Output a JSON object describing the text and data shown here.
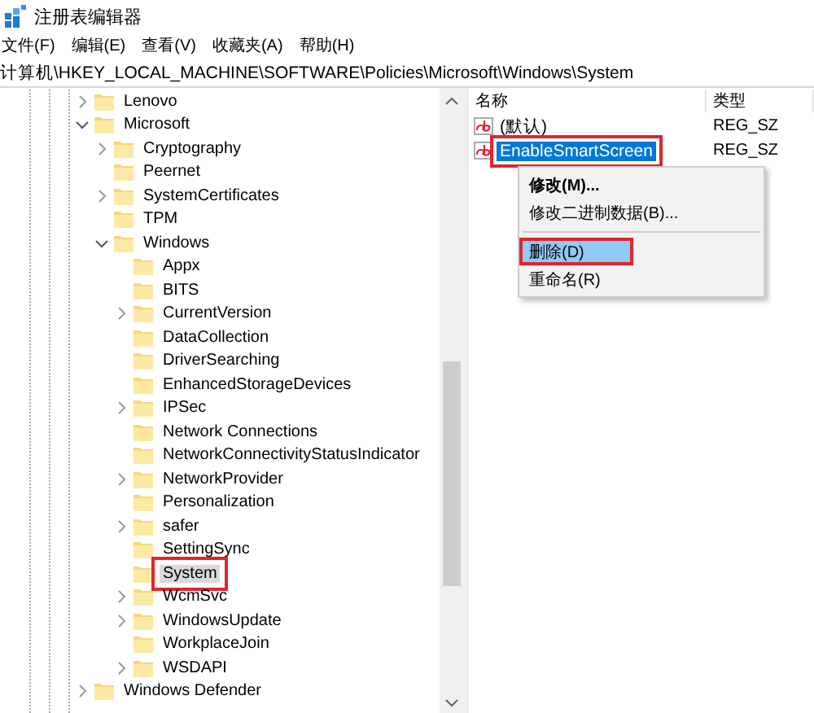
{
  "window": {
    "title": "注册表编辑器"
  },
  "menu": [
    "文件(F)",
    "编辑(E)",
    "查看(V)",
    "收藏夹(A)",
    "帮助(H)"
  ],
  "address": "计算机\\HKEY_LOCAL_MACHINE\\SOFTWARE\\Policies\\Microsoft\\Windows\\System",
  "tree": [
    {
      "label": "Lenovo",
      "kind": "node",
      "expanded": false,
      "selected": false
    },
    {
      "label": "Microsoft",
      "kind": "node",
      "expanded": true,
      "selected": false,
      "children": [
        {
          "label": "Cryptography",
          "kind": "node",
          "expanded": false,
          "selected": false
        },
        {
          "label": "Peernet",
          "kind": "leaf",
          "selected": false
        },
        {
          "label": "SystemCertificates",
          "kind": "node",
          "expanded": false,
          "selected": false
        },
        {
          "label": "TPM",
          "kind": "leaf",
          "selected": false
        },
        {
          "label": "Windows",
          "kind": "node",
          "expanded": true,
          "selected": false,
          "children": [
            {
              "label": "Appx",
              "kind": "leaf",
              "selected": false
            },
            {
              "label": "BITS",
              "kind": "leaf",
              "selected": false
            },
            {
              "label": "CurrentVersion",
              "kind": "node",
              "expanded": false,
              "selected": false
            },
            {
              "label": "DataCollection",
              "kind": "leaf",
              "selected": false
            },
            {
              "label": "DriverSearching",
              "kind": "leaf",
              "selected": false
            },
            {
              "label": "EnhancedStorageDevices",
              "kind": "leaf",
              "selected": false
            },
            {
              "label": "IPSec",
              "kind": "node",
              "expanded": false,
              "selected": false
            },
            {
              "label": "Network Connections",
              "kind": "leaf",
              "selected": false
            },
            {
              "label": "NetworkConnectivityStatusIndicator",
              "kind": "leaf",
              "selected": false
            },
            {
              "label": "NetworkProvider",
              "kind": "node",
              "expanded": false,
              "selected": false
            },
            {
              "label": "Personalization",
              "kind": "leaf",
              "selected": false
            },
            {
              "label": "safer",
              "kind": "node",
              "expanded": false,
              "selected": false
            },
            {
              "label": "SettingSync",
              "kind": "leaf",
              "selected": false
            },
            {
              "label": "System",
              "kind": "leaf",
              "selected": true,
              "annotated": true
            },
            {
              "label": "WcmSvc",
              "kind": "node",
              "expanded": false,
              "selected": false
            },
            {
              "label": "WindowsUpdate",
              "kind": "node",
              "expanded": false,
              "selected": false
            },
            {
              "label": "WorkplaceJoin",
              "kind": "leaf",
              "selected": false
            },
            {
              "label": "WSDAPI",
              "kind": "node",
              "expanded": false,
              "selected": false
            }
          ]
        }
      ]
    },
    {
      "label": "Windows Defender",
      "kind": "node",
      "expanded": false,
      "selected": false
    }
  ],
  "values": {
    "columns": [
      "名称",
      "类型"
    ],
    "rows": [
      {
        "name": "(默认)",
        "type": "REG_SZ",
        "selected": false,
        "annotated": false
      },
      {
        "name": "EnableSmartScreen",
        "type": "REG_SZ",
        "selected": true,
        "annotated": true
      }
    ]
  },
  "context_menu": [
    {
      "kind": "item",
      "label": "修改(M)...",
      "default": true,
      "selected": false,
      "annotated": false
    },
    {
      "kind": "item",
      "label": "修改二进制数据(B)...",
      "default": false,
      "selected": false,
      "annotated": false
    },
    {
      "kind": "separator"
    },
    {
      "kind": "item",
      "label": "删除(D)",
      "default": false,
      "selected": true,
      "annotated": true
    },
    {
      "kind": "item",
      "label": "重命名(R)",
      "default": false,
      "selected": false,
      "annotated": false
    }
  ]
}
